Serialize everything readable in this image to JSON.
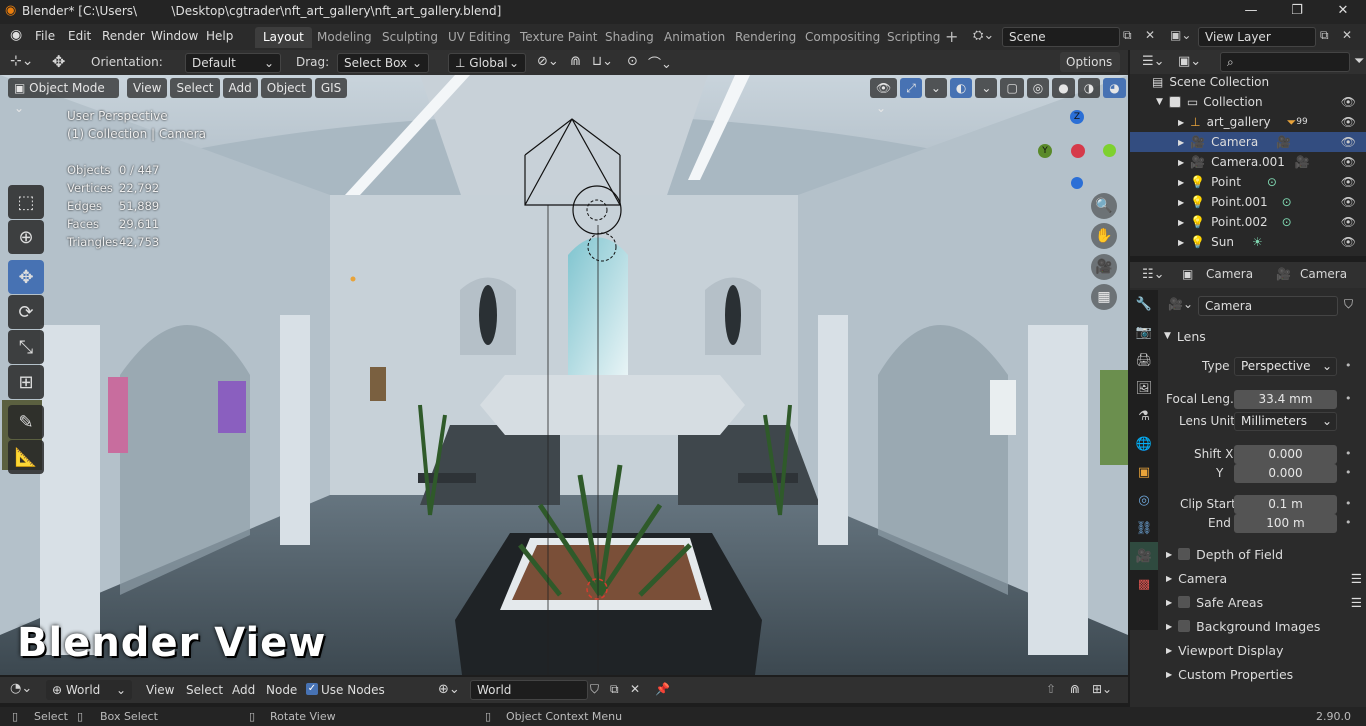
{
  "window": {
    "title": "Blender* [C:\\Users\\         \\Desktop\\cgtrader\\nft_art_gallery\\nft_art_gallery.blend]",
    "minimize": "—",
    "maximize": "❐",
    "close": "✕"
  },
  "menu": [
    "File",
    "Edit",
    "Render",
    "Window",
    "Help"
  ],
  "workspaces": [
    "Layout",
    "Modeling",
    "Sculpting",
    "UV Editing",
    "Texture Paint",
    "Shading",
    "Animation",
    "Rendering",
    "Compositing",
    "Scripting"
  ],
  "scene": {
    "name": "Scene",
    "view_layer": "View Layer"
  },
  "tool_header": {
    "orientation_label": "Orientation:",
    "orientation_value": "Default",
    "drag_label": "Drag:",
    "drag_value": "Select Box",
    "transform": "Global",
    "options": "Options"
  },
  "viewport_header": {
    "mode": "Object Mode",
    "items": [
      "View",
      "Select",
      "Add",
      "Object",
      "GIS"
    ]
  },
  "viewport_info": {
    "view": "User Perspective",
    "context": "(1) Collection | Camera",
    "stats": [
      {
        "label": "Objects",
        "value": "0 / 447"
      },
      {
        "label": "Vertices",
        "value": "22,792"
      },
      {
        "label": "Edges",
        "value": "51,889"
      },
      {
        "label": "Faces",
        "value": "29,611"
      },
      {
        "label": "Triangles",
        "value": "42,753"
      }
    ]
  },
  "gizmo": {
    "z": "Z",
    "y": "Y"
  },
  "overlay_text": "Blender View",
  "node_header": {
    "world_type": "World",
    "items": [
      "View",
      "Select",
      "Add",
      "Node"
    ],
    "use_nodes": "Use Nodes",
    "world_name": "World"
  },
  "status_bar": {
    "select": "Select",
    "box_select": "Box Select",
    "rotate": "Rotate View",
    "context_menu": "Object Context Menu",
    "version": "2.90.0"
  },
  "outliner": {
    "root": "Scene Collection",
    "collection": "Collection",
    "items": [
      {
        "name": "art_gallery",
        "badge": "99"
      },
      {
        "name": "Camera"
      },
      {
        "name": "Camera.001"
      },
      {
        "name": "Point"
      },
      {
        "name": "Point.001"
      },
      {
        "name": "Point.002"
      },
      {
        "name": "Sun"
      }
    ]
  },
  "properties": {
    "breadcrumb": [
      "Camera",
      "Camera"
    ],
    "datablock": "Camera",
    "lens_section": "Lens",
    "type_label": "Type",
    "type_value": "Perspective",
    "focal_label": "Focal Leng...",
    "focal_value": "33.4 mm",
    "lens_unit_label": "Lens Unit",
    "lens_unit_value": "Millimeters",
    "shift_x_label": "Shift X",
    "shift_x_value": "0.000",
    "shift_y_label": "Y",
    "shift_y_value": "0.000",
    "clip_start_label": "Clip Start",
    "clip_start_value": "0.1 m",
    "clip_end_label": "End",
    "clip_end_value": "100 m",
    "sections": [
      "Depth of Field",
      "Camera",
      "Safe Areas",
      "Background Images",
      "Viewport Display",
      "Custom Properties"
    ]
  }
}
